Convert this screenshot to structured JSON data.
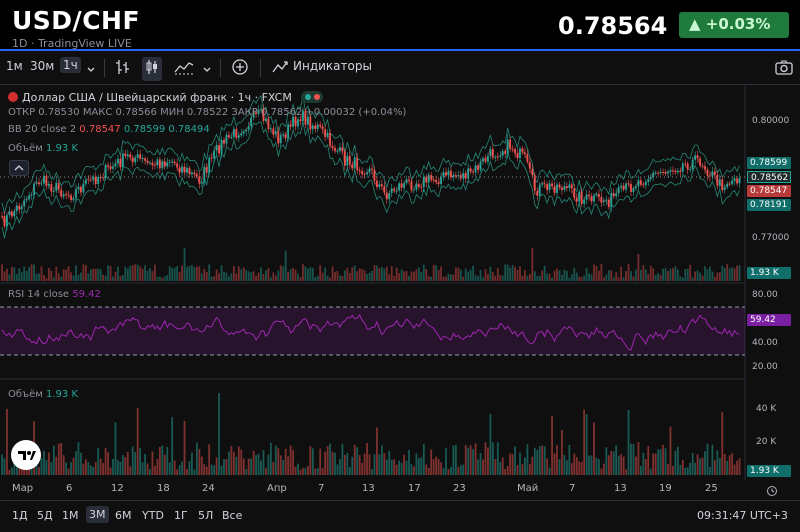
{
  "header": {
    "symbol": "USD/CHF",
    "subtitle": "1D · TradingView LIVE",
    "price": "0.78564",
    "change": "▲ +0.03%"
  },
  "toolbar": {
    "intervals": [
      "1м",
      "30м",
      "1ч"
    ],
    "active_interval": "1ч",
    "indicators_label": "Индикаторы",
    "icons": [
      "chevron-down-icon",
      "bar-chart-icon",
      "candles-icon",
      "area-chart-icon",
      "chevron-down-icon",
      "plus-circle-icon",
      "indicators-icon",
      "camera-icon"
    ]
  },
  "legend": {
    "title": "Доллар США / Швейцарский франк · 1ч · FXCM",
    "ohlc": "ОТКР 0.78530  МАКС 0.78566  МИН 0.78522  ЗАКР 0.78562  +0.00032 (+0.04%)",
    "bb_label": "BB 20 close 2",
    "bb_values": [
      "0.78547",
      "0.78599",
      "0.78494"
    ],
    "volume_label": "Объём",
    "volume_value": "1.93 K",
    "rsi_label": "RSI 14 close",
    "rsi_value": "59.42",
    "volume2_label": "Объём",
    "volume2_value": "1.93 K"
  },
  "price_axis": {
    "ticks": [
      "0.80000",
      "0.77000"
    ],
    "badges": [
      "0.78599",
      "0.78562",
      "0.78547",
      "0.78191"
    ],
    "volume_badge": "1.93 K",
    "rsi_ticks": [
      "80.00",
      "40.00",
      "20.00"
    ],
    "rsi_badge": "59.42",
    "vol_ticks": [
      "40 K",
      "20 K"
    ],
    "vol_badge": "1.93 K"
  },
  "time_axis": {
    "labels": [
      "Мар",
      "6",
      "12",
      "18",
      "24",
      "Апр",
      "7",
      "13",
      "17",
      "23",
      "Май",
      "7",
      "13",
      "19",
      "25"
    ]
  },
  "bottom": {
    "ranges": [
      "1Д",
      "5Д",
      "1М",
      "3М",
      "6М",
      "YTD",
      "1Г",
      "5Л",
      "Все"
    ],
    "active_range": "3М",
    "time": "09:31:47 UTC+3"
  },
  "colors": {
    "up": "#26a69a",
    "down": "#ef5350",
    "bb": "#2aa692",
    "rsi": "#9c27b0",
    "accent": "#2962ff"
  }
}
